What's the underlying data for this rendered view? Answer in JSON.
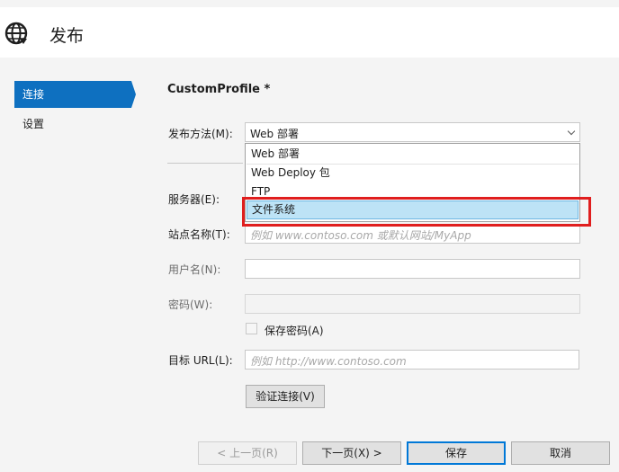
{
  "header": {
    "title": "发布",
    "icon": "globe-icon"
  },
  "sidebar": {
    "items": [
      {
        "label": "连接",
        "active": true
      },
      {
        "label": "设置",
        "active": false
      }
    ]
  },
  "form": {
    "profile_title": "CustomProfile *",
    "method_label": "发布方法(M):",
    "method_value": "Web 部署",
    "method_options": [
      "Web 部署",
      "Web Deploy 包",
      "FTP",
      "文件系统"
    ],
    "highlighted_option": "文件系统",
    "server_label": "服务器(E):",
    "site_label": "站点名称(T):",
    "site_placeholder": "例如 www.contoso.com 或默认网站/MyApp",
    "username_label": "用户名(N):",
    "password_label": "密码(W):",
    "save_password_label": "保存密码(A)",
    "target_url_label": "目标 URL(L):",
    "target_url_placeholder": "例如 http://www.contoso.com",
    "validate_button": "验证连接(V)"
  },
  "footer": {
    "prev_button": "< 上一页(R)",
    "next_button": "下一页(X) >",
    "save_button": "保存",
    "cancel_button": "取消"
  },
  "colors": {
    "accent": "#0e70c0",
    "selection": "#bde3f6",
    "annotation_red": "#e01e1e"
  }
}
